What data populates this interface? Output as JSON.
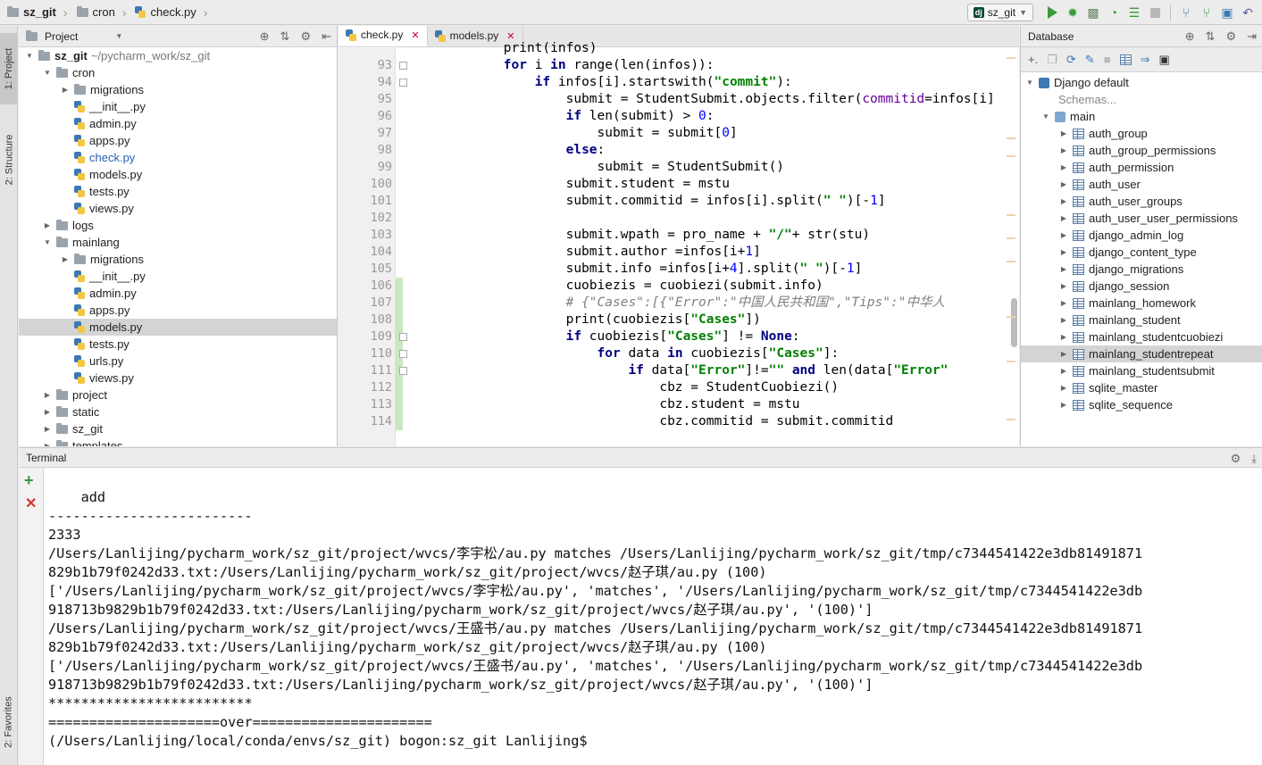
{
  "navbar": {
    "project": "sz_git",
    "folder": "cron",
    "file": "check.py",
    "run_config": "sz_git"
  },
  "left_strip": {
    "project_tab": "1: Project",
    "structure_tab": "2: Structure",
    "favorites_tab": "2: Favorites"
  },
  "project_panel": {
    "title": "Project",
    "tree": [
      {
        "label": "sz_git",
        "hint": "~/pycharm_work/sz_git",
        "kind": "folder",
        "depth": 0,
        "expanded": true,
        "bold": true
      },
      {
        "label": "cron",
        "kind": "folder",
        "depth": 1,
        "expanded": true
      },
      {
        "label": "migrations",
        "kind": "folder",
        "depth": 2,
        "expanded": false
      },
      {
        "label": "__init__.py",
        "kind": "py",
        "depth": 2
      },
      {
        "label": "admin.py",
        "kind": "py",
        "depth": 2
      },
      {
        "label": "apps.py",
        "kind": "py",
        "depth": 2
      },
      {
        "label": "check.py",
        "kind": "py",
        "depth": 2,
        "blue": true
      },
      {
        "label": "models.py",
        "kind": "py",
        "depth": 2
      },
      {
        "label": "tests.py",
        "kind": "py",
        "depth": 2
      },
      {
        "label": "views.py",
        "kind": "py",
        "depth": 2
      },
      {
        "label": "logs",
        "kind": "folder",
        "depth": 1,
        "expanded": false
      },
      {
        "label": "mainlang",
        "kind": "folder",
        "depth": 1,
        "expanded": true
      },
      {
        "label": "migrations",
        "kind": "folder",
        "depth": 2,
        "expanded": false
      },
      {
        "label": "__init__.py",
        "kind": "py",
        "depth": 2
      },
      {
        "label": "admin.py",
        "kind": "py",
        "depth": 2
      },
      {
        "label": "apps.py",
        "kind": "py",
        "depth": 2
      },
      {
        "label": "models.py",
        "kind": "py",
        "depth": 2,
        "selected": true
      },
      {
        "label": "tests.py",
        "kind": "py",
        "depth": 2
      },
      {
        "label": "urls.py",
        "kind": "py",
        "depth": 2
      },
      {
        "label": "views.py",
        "kind": "py",
        "depth": 2
      },
      {
        "label": "project",
        "kind": "folder",
        "depth": 1,
        "expanded": false
      },
      {
        "label": "static",
        "kind": "folder",
        "depth": 1,
        "expanded": false
      },
      {
        "label": "sz_git",
        "kind": "folder",
        "depth": 1,
        "expanded": false
      },
      {
        "label": "templates",
        "kind": "folder",
        "depth": 1,
        "expanded": false
      }
    ]
  },
  "editor": {
    "tabs": [
      {
        "label": "check.py",
        "active": true
      },
      {
        "label": "models.py",
        "active": false
      }
    ],
    "partial_line": "            print(infos)",
    "lines": [
      {
        "n": "93",
        "html": "            <span class=\"kw\">for</span> i <span class=\"kw\">in</span> range(len(infos)):"
      },
      {
        "n": "94",
        "html": "                <span class=\"kw\">if</span> infos[i].startswith(<span class=\"str\">\"commit\"</span>):"
      },
      {
        "n": "95",
        "html": "                    submit = StudentSubmit.objects.filter(<span class=\"param\">commitid</span>=infos[i]"
      },
      {
        "n": "96",
        "html": "                    <span class=\"kw\">if</span> len(submit) &gt; <span class=\"num\">0</span>:"
      },
      {
        "n": "97",
        "html": "                        submit = submit[<span class=\"num\">0</span>]"
      },
      {
        "n": "98",
        "html": "                    <span class=\"kw\">else</span>:"
      },
      {
        "n": "99",
        "html": "                        submit = StudentSubmit()"
      },
      {
        "n": "100",
        "html": "                    submit.student = mstu"
      },
      {
        "n": "101",
        "html": "                    submit.commitid = infos[i].split(<span class=\"str\">\" \"</span>)[-<span class=\"num\">1</span>]"
      },
      {
        "n": "102",
        "html": ""
      },
      {
        "n": "103",
        "html": "                    submit.wpath = pro_name + <span class=\"str\">\"/\"</span>+ str(stu)"
      },
      {
        "n": "104",
        "html": "                    submit.author =infos[i+<span class=\"num\">1</span>]"
      },
      {
        "n": "105",
        "html": "                    submit.info =infos[i+<span class=\"num\">4</span>].split(<span class=\"str\">\" \"</span>)[-<span class=\"num\">1</span>]"
      },
      {
        "n": "106",
        "html": "                    cuobiezis = cuobiezi(submit.info)"
      },
      {
        "n": "107",
        "html": "                    <span class=\"cmt\"># {\"Cases\":[{\"Error\":\"中国人民共和国\",\"Tips\":\"中华人</span>"
      },
      {
        "n": "108",
        "html": "                    print(cuobiezis[<span class=\"str\">\"Cases\"</span>])"
      },
      {
        "n": "109",
        "html": "                    <span class=\"kw\">if</span> cuobiezis[<span class=\"str\">\"Cases\"</span>] != <span class=\"kw\">None</span>:"
      },
      {
        "n": "110",
        "html": "                        <span class=\"kw\">for</span> data <span class=\"kw\">in</span> cuobiezis[<span class=\"str\">\"Cases\"</span>]:"
      },
      {
        "n": "111",
        "html": "                            <span class=\"kw\">if</span> data[<span class=\"str\">\"Error\"</span>]!=<span class=\"str\">\"\"</span> <span class=\"kw\">and</span> len(data[<span class=\"str\">\"Error\"</span>"
      },
      {
        "n": "112",
        "html": "                                cbz = StudentCuobiezi()"
      },
      {
        "n": "113",
        "html": "                                cbz.student = mstu"
      },
      {
        "n": "114",
        "html": "                                cbz.commitid = submit.commitid"
      }
    ]
  },
  "database": {
    "title": "Database",
    "datasource": "Django default",
    "schemas_label": "Schemas...",
    "schema": "main",
    "tables": [
      "auth_group",
      "auth_group_permissions",
      "auth_permission",
      "auth_user",
      "auth_user_groups",
      "auth_user_user_permissions",
      "django_admin_log",
      "django_content_type",
      "django_migrations",
      "django_session",
      "mainlang_homework",
      "mainlang_student",
      "mainlang_studentcuobiezi",
      "mainlang_studentrepeat",
      "mainlang_studentsubmit",
      "sqlite_master",
      "sqlite_sequence"
    ],
    "selected_table": "mainlang_studentrepeat"
  },
  "terminal": {
    "title": "Terminal",
    "lines": [
      "    add",
      "-------------------------",
      "2333",
      "/Users/Lanlijing/pycharm_work/sz_git/project/wvcs/李宇松/au.py matches /Users/Lanlijing/pycharm_work/sz_git/tmp/c7344541422e3db81491871",
      "829b1b79f0242d33.txt:/Users/Lanlijing/pycharm_work/sz_git/project/wvcs/赵子琪/au.py (100)",
      "['/Users/Lanlijing/pycharm_work/sz_git/project/wvcs/李宇松/au.py', 'matches', '/Users/Lanlijing/pycharm_work/sz_git/tmp/c7344541422e3db",
      "918713b9829b1b79f0242d33.txt:/Users/Lanlijing/pycharm_work/sz_git/project/wvcs/赵子琪/au.py', '(100)']",
      "/Users/Lanlijing/pycharm_work/sz_git/project/wvcs/王盛书/au.py matches /Users/Lanlijing/pycharm_work/sz_git/tmp/c7344541422e3db81491871",
      "829b1b79f0242d33.txt:/Users/Lanlijing/pycharm_work/sz_git/project/wvcs/赵子琪/au.py (100)",
      "['/Users/Lanlijing/pycharm_work/sz_git/project/wvcs/王盛书/au.py', 'matches', '/Users/Lanlijing/pycharm_work/sz_git/tmp/c7344541422e3db",
      "918713b9829b1b79f0242d33.txt:/Users/Lanlijing/pycharm_work/sz_git/project/wvcs/赵子琪/au.py', '(100)']",
      "*************************",
      "=====================over======================",
      "(/Users/Lanlijing/local/conda/envs/sz_git) bogon:sz_git Lanlijing$"
    ]
  }
}
